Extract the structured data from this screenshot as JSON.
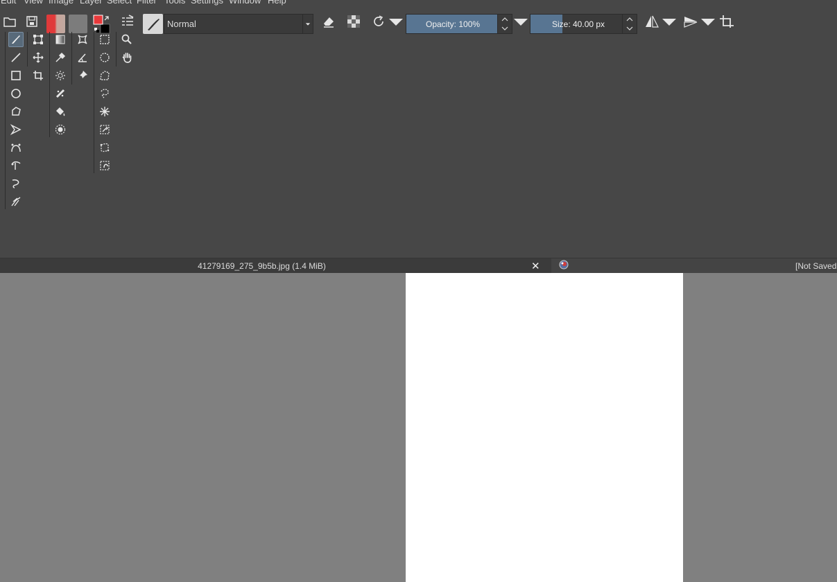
{
  "menu": [
    "Edit",
    "View",
    "Image",
    "Layer",
    "Select",
    "Filter",
    "Tools",
    "Settings",
    "Window",
    "Help"
  ],
  "toolbar": {
    "blend_mode": "Normal",
    "opacity_label": "Opacity: 100%",
    "opacity_fraction": 1.0,
    "size_label": "Size: 40.00 px",
    "colors": {
      "foreground": "#e8393b",
      "background": "#000000",
      "accent": "#587592"
    }
  },
  "document": {
    "tab_title": "41279169_275_9b5b.jpg (1.4 MiB)",
    "status": "[Not Saved"
  }
}
